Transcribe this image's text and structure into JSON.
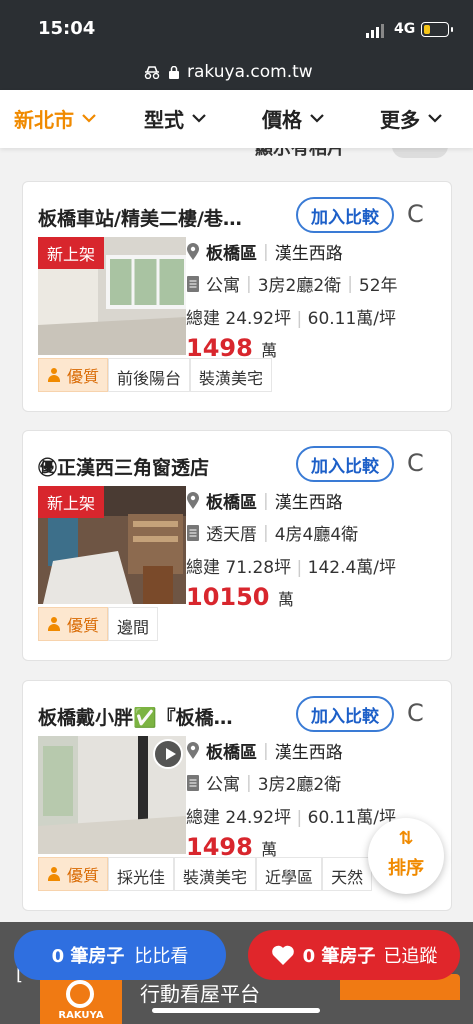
{
  "status": {
    "time": "15:04",
    "network": "4G"
  },
  "browser": {
    "url": "rakuya.com.tw"
  },
  "filters": [
    {
      "label": "新北市"
    },
    {
      "label": "型式"
    },
    {
      "label": "價格"
    },
    {
      "label": "更多"
    }
  ],
  "peek_text": "顯示有相片",
  "listings": [
    {
      "title": "板橋車站/精美二樓/巷…",
      "compare_label": "加入比較",
      "new_label": "新上架",
      "district": "板橋區",
      "road": "漢生西路",
      "type": "公寓",
      "layout": "3房2廳2衛",
      "age": "52年",
      "area": "總建 24.92坪",
      "unit_price": "60.11萬/坪",
      "price": "1498",
      "price_unit": "萬",
      "tags": [
        "優質",
        "前後陽台",
        "裝潢美宅"
      ]
    },
    {
      "title": "㊝正漢西三角窗透店",
      "compare_label": "加入比較",
      "new_label": "新上架",
      "district": "板橋區",
      "road": "漢生西路",
      "type": "透天厝",
      "layout": "4房4廳4衛",
      "area": "總建 71.28坪",
      "unit_price": "142.4萬/坪",
      "price": "10150",
      "price_unit": "萬",
      "tags": [
        "優質",
        "邊間"
      ]
    },
    {
      "title": "板橋戴小胖✅『板橋…",
      "compare_label": "加入比較",
      "district": "板橋區",
      "road": "漢生西路",
      "type": "公寓",
      "layout": "3房2廳2衛",
      "area": "總建 24.92坪",
      "unit_price": "60.11萬/坪",
      "price": "1498",
      "price_unit": "萬",
      "tags": [
        "優質",
        "採光佳",
        "裝潢美宅",
        "近學區",
        "天然"
      ]
    }
  ],
  "sort": {
    "icon": "sort-icon",
    "label": "排序"
  },
  "bottom_bar": {
    "compare": {
      "count": "0 筆房子",
      "label": "比比看"
    },
    "tracked": {
      "count": "0 筆房子",
      "label": "已追蹤"
    },
    "banner_text": "行動看屋平台",
    "logo_text": "RAKUYA"
  },
  "colors": {
    "accent": "#f08a00",
    "price": "#d8262d",
    "compare": "#2f6fe0",
    "track": "#e0262b"
  }
}
